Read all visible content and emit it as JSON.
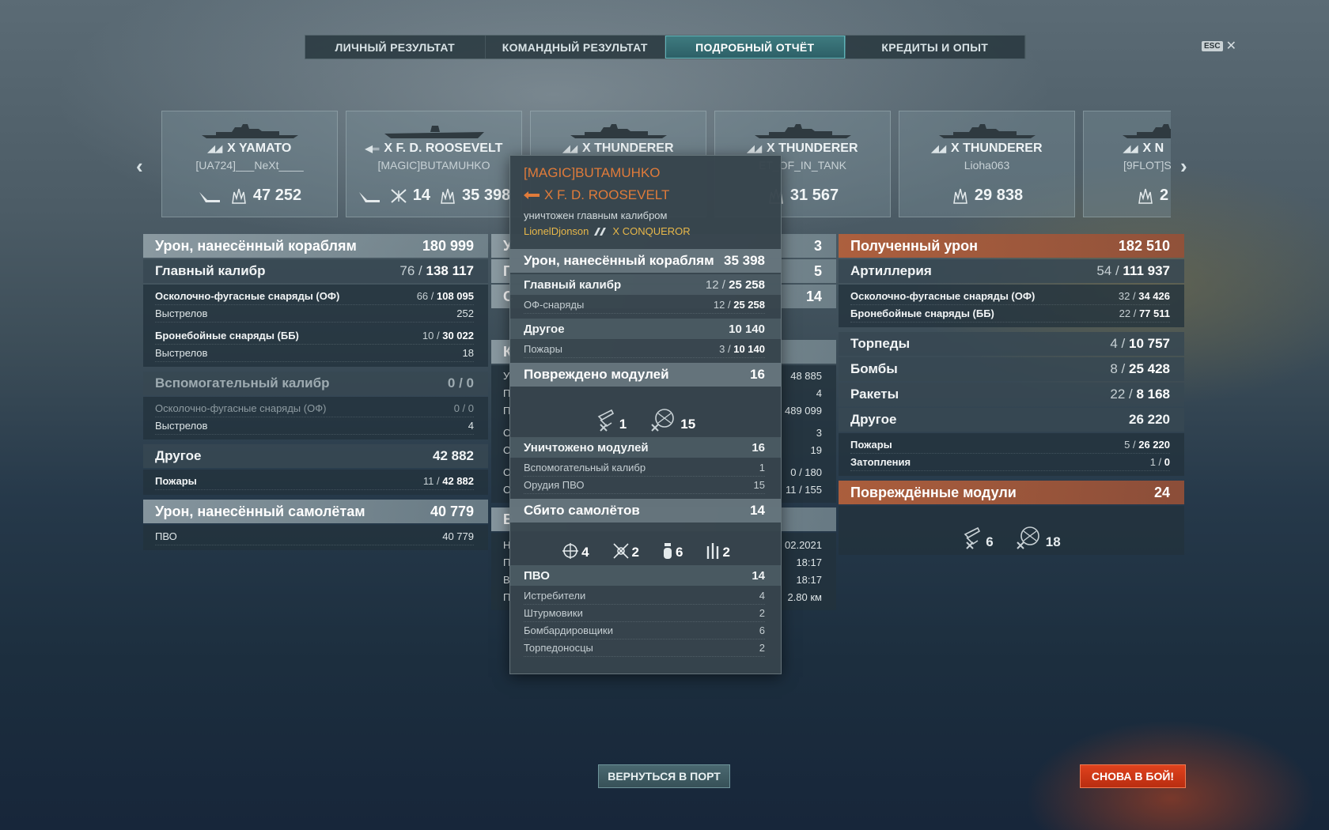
{
  "tabs": [
    "ЛИЧНЫЙ РЕЗУЛЬТАТ",
    "КОМАНДНЫЙ РЕЗУЛЬТАТ",
    "ПОДРОБНЫЙ ОТЧЁТ",
    "КРЕДИТЫ И ОПЫТ"
  ],
  "active_tab": 2,
  "esc": {
    "key": "ESC",
    "close": "✕"
  },
  "carousel": {
    "prev": "‹",
    "next": "›",
    "cards": [
      {
        "ship": "X YAMATO",
        "player": "[UA724]___NeXt____",
        "planes": "",
        "damage": "47 252"
      },
      {
        "ship": "X F. D. ROOSEVELT",
        "player": "[MAGIC]BUTAMUHKO",
        "planes": "14",
        "damage": "35 398"
      },
      {
        "ship": "X THUNDERER",
        "player": "",
        "planes": "",
        "damage": ""
      },
      {
        "ship": "X THUNDERER",
        "player": "ET_OF_IN_TANK",
        "planes": "",
        "damage": "31 567"
      },
      {
        "ship": "X THUNDERER",
        "player": "Lioha063",
        "planes": "",
        "damage": "29 838"
      },
      {
        "ship": "X N",
        "player": "[9FLOT]S",
        "planes": "",
        "damage": "2"
      }
    ]
  },
  "left": {
    "dealt": {
      "label": "Урон, нанесённый кораблям",
      "value": "180 999"
    },
    "main": {
      "label": "Главный калибр",
      "hits": "76",
      "dmg": "138 117"
    },
    "he": {
      "label": "Осколочно-фугасные снаряды (ОФ)",
      "hits": "66",
      "dmg": "108 095"
    },
    "he_shots": {
      "label": "Выстрелов",
      "value": "252"
    },
    "ap": {
      "label": "Бронебойные снаряды (ББ)",
      "hits": "10",
      "dmg": "30 022"
    },
    "ap_shots": {
      "label": "Выстрелов",
      "value": "18"
    },
    "sec": {
      "label": "Вспомогательный калибр",
      "value": "0 / 0"
    },
    "sec_he": {
      "label": "Осколочно-фугасные снаряды (ОФ)",
      "value": "0 / 0"
    },
    "sec_shots": {
      "label": "Выстрелов",
      "value": "4"
    },
    "other": {
      "label": "Другое",
      "value": "42 882"
    },
    "fires": {
      "label": "Пожары",
      "hits": "11",
      "dmg": "42 882"
    },
    "planes": {
      "label": "Урон, нанесённый самолётам",
      "value": "40 779"
    },
    "aa": {
      "label": "ПВО",
      "value": "40 779"
    }
  },
  "middle": {
    "h1": {
      "label": "У",
      "value": "3"
    },
    "h2": {
      "label": "Г",
      "value": "5"
    },
    "h3": {
      "label": "С",
      "value": "14"
    },
    "k": "К",
    "rows": [
      {
        "label": "У",
        "value": "48 885"
      },
      {
        "label": "П",
        "value": "4"
      },
      {
        "label": "П",
        "value": "489 099"
      },
      {
        "label": "О",
        "value": "3"
      },
      {
        "label": "О",
        "value": "19"
      },
      {
        "label": "О",
        "value": "0 / 180"
      },
      {
        "label": "О",
        "value": "11 / 155"
      }
    ],
    "b": "В",
    "rows2": [
      {
        "label": "Н",
        "value": "02.2021"
      },
      {
        "label": "П",
        "value": "18:17"
      },
      {
        "label": "В",
        "value": "18:17"
      },
      {
        "label": "П",
        "value": "2.80 км"
      }
    ]
  },
  "tooltip": {
    "player": "[MAGIC]BUTAMUHKO",
    "ship": "X F. D. ROOSEVELT",
    "killed_by": "уничтожен главным калибром",
    "killer": "LionelDjonson",
    "killer_ship": "X CONQUEROR",
    "dealt": {
      "label": "Урон, нанесённый кораблям",
      "value": "35 398"
    },
    "main": {
      "label": "Главный калибр",
      "hits": "12",
      "dmg": "25 258"
    },
    "he": {
      "label": "ОФ-снаряды",
      "hits": "12",
      "dmg": "25 258"
    },
    "other": {
      "label": "Другое",
      "value": "10 140"
    },
    "fires": {
      "label": "Пожары",
      "hits": "3",
      "dmg": "10 140"
    },
    "modules_damaged": {
      "label": "Повреждено модулей",
      "value": "16"
    },
    "mod_icons": [
      {
        "icon": "secondary-gun-icon",
        "count": "1"
      },
      {
        "icon": "aa-mount-icon",
        "count": "15"
      }
    ],
    "modules_destroyed": {
      "label": "Уничтожено модулей",
      "value": "16"
    },
    "md_sec": {
      "label": "Вспомогательный калибр",
      "value": "1"
    },
    "md_aa": {
      "label": "Орудия ПВО",
      "value": "15"
    },
    "planes": {
      "label": "Сбито самолётов",
      "value": "14"
    },
    "plane_icons": [
      {
        "icon": "fighter-icon",
        "count": "4"
      },
      {
        "icon": "attack-plane-icon",
        "count": "2"
      },
      {
        "icon": "bomber-icon",
        "count": "6"
      },
      {
        "icon": "torpedo-bomber-icon",
        "count": "2"
      }
    ],
    "aa": {
      "label": "ПВО",
      "value": "14"
    },
    "fighters": {
      "label": "Истребители",
      "value": "4"
    },
    "attack": {
      "label": "Штурмовики",
      "value": "2"
    },
    "bombers": {
      "label": "Бомбардировщики",
      "value": "6"
    },
    "torpedo": {
      "label": "Торпедоносцы",
      "value": "2"
    }
  },
  "right": {
    "received": {
      "label": "Полученный урон",
      "value": "182 510"
    },
    "art": {
      "label": "Артиллерия",
      "hits": "54",
      "dmg": "111 937"
    },
    "he": {
      "label": "Осколочно-фугасные снаряды (ОФ)",
      "hits": "32",
      "dmg": "34 426"
    },
    "ap": {
      "label": "Бронебойные снаряды (ББ)",
      "hits": "22",
      "dmg": "77 511"
    },
    "torp": {
      "label": "Торпеды",
      "hits": "4",
      "dmg": "10 757"
    },
    "bombs": {
      "label": "Бомбы",
      "hits": "8",
      "dmg": "25 428"
    },
    "rockets": {
      "label": "Ракеты",
      "hits": "22",
      "dmg": "8 168"
    },
    "other": {
      "label": "Другое",
      "value": "26 220"
    },
    "fires": {
      "label": "Пожары",
      "hits": "5",
      "dmg": "26 220"
    },
    "flood": {
      "label": "Затопления",
      "hits": "1",
      "dmg": "0"
    },
    "modules": {
      "label": "Повреждённые модули",
      "value": "24"
    },
    "mod_icons": [
      {
        "icon": "secondary-gun-icon",
        "count": "6"
      },
      {
        "icon": "aa-mount-icon",
        "count": "18"
      }
    ]
  },
  "buttons": {
    "port": "ВЕРНУТЬСЯ В ПОРТ",
    "battle": "СНОВА В БОЙ!"
  },
  "colors": {
    "accent": "#3f7b80",
    "orange": "#e07b3a",
    "battle": "#d33a17",
    "killer": "#e8b84a"
  }
}
